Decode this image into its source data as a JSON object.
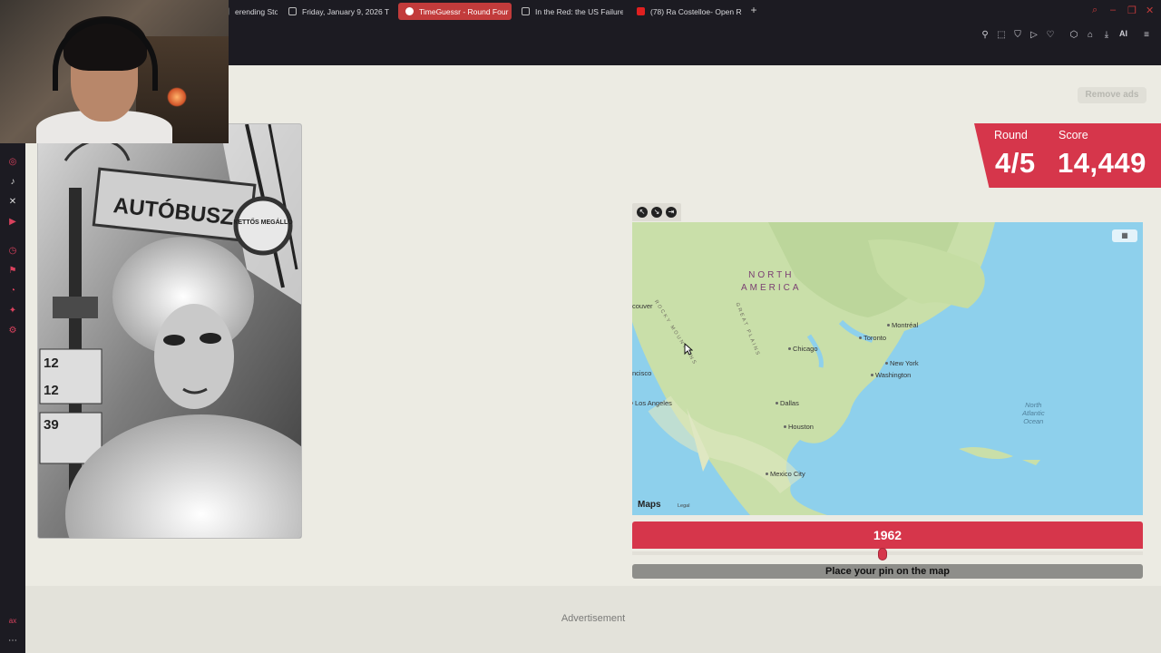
{
  "browser": {
    "tabs": [
      {
        "label": "erending Sto",
        "icon": "globe-icon"
      },
      {
        "label": "Friday, January 9, 2026 T",
        "icon": "calendar-icon"
      },
      {
        "label": "TimeGuessr - Round Four",
        "icon": "globe-icon",
        "active": true
      },
      {
        "label": "In the Red: the US Failure",
        "icon": "document-icon"
      },
      {
        "label": "(78) Ra Costelloe- Open R",
        "icon": "youtube-icon"
      }
    ],
    "new_tab": "+",
    "toolbar_ai": "AI"
  },
  "page": {
    "remove_ads": "Remove ads",
    "round_label": "Round",
    "round_value": "4/5",
    "score_label": "Score",
    "score_value": "14,449",
    "year": "1962",
    "place_pin": "Place your pin on the map",
    "advertisement": "Advertisement",
    "year_slider_fraction": 0.49
  },
  "photo": {
    "sign_text": "AUTÓBUSZ",
    "stop_text": "KETTŐS MEGÁLLÓ",
    "route_numbers": [
      "12",
      "12",
      "39"
    ]
  },
  "map": {
    "region": [
      "NORTH",
      "AMERICA"
    ],
    "mountains": [
      "ROCKY MOUNTAINS",
      "GREAT PLAINS"
    ],
    "cities": [
      "couver",
      "ncisco",
      "Los Angeles",
      "Chicago",
      "Toronto",
      "Montréal",
      "New York",
      "Washington",
      "Dallas",
      "Houston",
      "Mexico City"
    ],
    "ocean": [
      "North",
      "Atlantic",
      "Ocean"
    ],
    "logo": "Maps",
    "legal": "Legal"
  },
  "colors": {
    "accent": "#d6364b",
    "page_bg": "#ecebe3"
  }
}
